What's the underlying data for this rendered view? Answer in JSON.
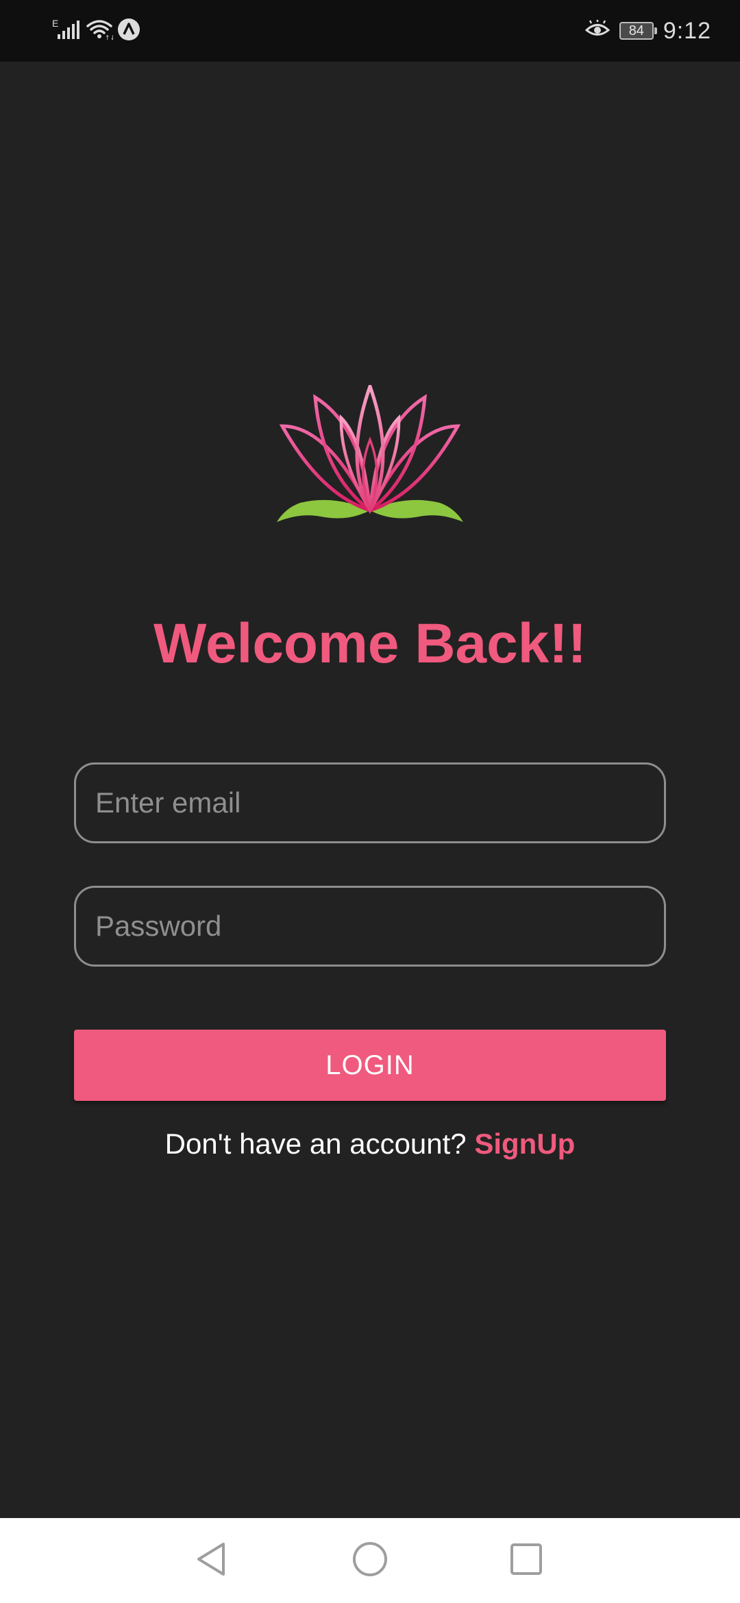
{
  "status_bar": {
    "network_type": "E",
    "battery_level": "84",
    "time": "9:12"
  },
  "login": {
    "title": "Welcome Back!!",
    "email_placeholder": "Enter email",
    "password_placeholder": "Password",
    "login_label": "LOGIN",
    "signup_prompt": "Don't have an account?",
    "signup_link": "SignUp"
  },
  "icons": {
    "status_left": [
      "signal-icon",
      "wifi-icon",
      "app-notification-icon"
    ],
    "status_right": [
      "eye-comfort-icon",
      "battery-icon"
    ],
    "logo": "lotus-logo",
    "nav": [
      "back-icon",
      "home-icon",
      "recents-icon"
    ]
  },
  "colors": {
    "background": "#222222",
    "status_bar": "#0f0f0f",
    "accent": "#f05a7e",
    "input_border": "#8e8e8e",
    "placeholder": "#8f8f8f",
    "leaf_green": "#8dc63f",
    "nav_bar": "#ffffff"
  }
}
